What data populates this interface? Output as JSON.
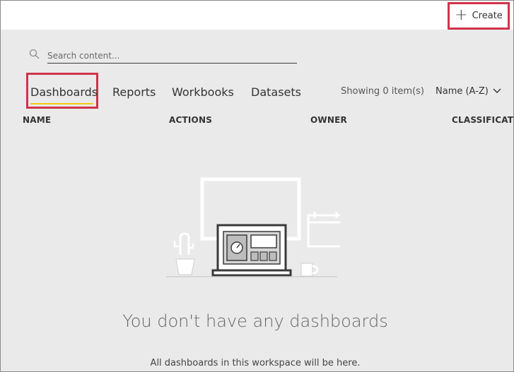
{
  "topbar": {
    "create_label": "Create"
  },
  "search": {
    "placeholder": "Search content..."
  },
  "tabs": [
    {
      "label": "Dashboards",
      "active": true
    },
    {
      "label": "Reports"
    },
    {
      "label": "Workbooks"
    },
    {
      "label": "Datasets"
    }
  ],
  "list_meta": {
    "showing_text": "Showing 0 item(s)",
    "sort_label": "Name (A-Z)"
  },
  "columns": [
    "NAME",
    "ACTIONS",
    "OWNER",
    "CLASSIFICATIO"
  ],
  "empty_state": {
    "title": "You don't have any dashboards",
    "subtitle": "All dashboards in this workspace will be here."
  },
  "colors": {
    "highlight": "#d0334a",
    "active_underline": "#f2c811",
    "background": "#eaeaea"
  }
}
